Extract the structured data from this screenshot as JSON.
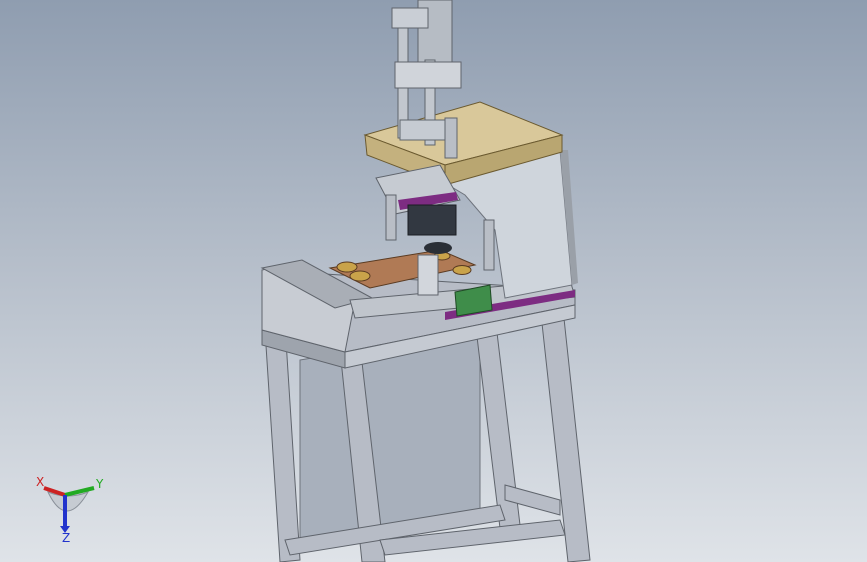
{
  "viewport": {
    "background_top": "#8f9db0",
    "background_bottom": "#dfe3e8"
  },
  "model": {
    "frame_color": "#b7bcc6",
    "frame_shadow": "#6e737c",
    "plate_top_color": "#d9c89a",
    "plate_side_color": "#c4b17e",
    "housing_color": "#cfd5dc",
    "base_accent": "#7d2c82",
    "die_plate_color": "#b07a55",
    "bracket_color": "#3f8d4a",
    "panel_color": "#a8b0bc"
  },
  "triad": {
    "x_label": "X",
    "y_label": "Y",
    "z_label": "Z",
    "x_color": "#cc2222",
    "y_color": "#22aa22",
    "z_color": "#2233cc"
  }
}
